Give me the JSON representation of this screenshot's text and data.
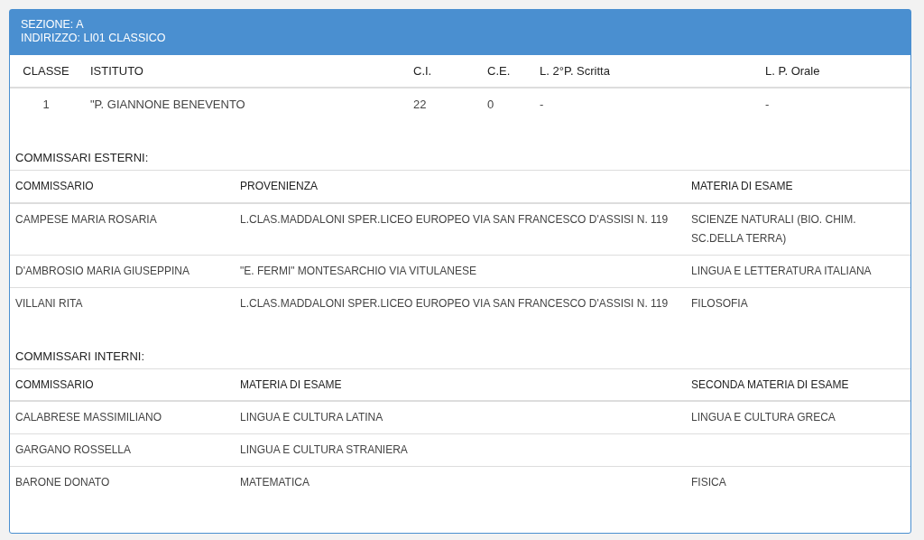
{
  "header": {
    "sezione": "SEZIONE: A",
    "indirizzo": "INDIRIZZO: LI01 CLASSICO"
  },
  "classi": {
    "columns": [
      "CLASSE",
      "ISTITUTO",
      "C.I.",
      "C.E.",
      "L. 2°P. Scritta",
      "L. P. Orale"
    ],
    "rows": [
      [
        "1",
        "\"P. GIANNONE BENEVENTO",
        "22",
        "0",
        "-",
        "-"
      ]
    ]
  },
  "sections": [
    {
      "title": "COMMISSARI ESTERNI:",
      "columns": [
        "COMMISSARIO",
        "PROVENIENZA",
        "MATERIA DI ESAME"
      ],
      "rows": [
        [
          "CAMPESE MARIA ROSARIA",
          "L.CLAS.MADDALONI SPER.LICEO EUROPEO VIA SAN FRANCESCO D'ASSISI N. 119",
          "SCIENZE NATURALI (BIO. CHIM. SC.DELLA TERRA)"
        ],
        [
          "D'AMBROSIO MARIA GIUSEPPINA",
          "\"E. FERMI\" MONTESARCHIO VIA VITULANESE",
          "LINGUA E LETTERATURA ITALIANA"
        ],
        [
          "VILLANI RITA",
          "L.CLAS.MADDALONI SPER.LICEO EUROPEO VIA SAN FRANCESCO D'ASSISI N. 119",
          "FILOSOFIA"
        ]
      ]
    },
    {
      "title": "COMMISSARI INTERNI:",
      "columns": [
        "COMMISSARIO",
        "MATERIA DI ESAME",
        "SECONDA MATERIA DI ESAME"
      ],
      "rows": [
        [
          "CALABRESE MASSIMILIANO",
          "LINGUA E CULTURA LATINA",
          "LINGUA E CULTURA GRECA"
        ],
        [
          "GARGANO ROSSELLA",
          "LINGUA E CULTURA STRANIERA"
        ],
        [
          "BARONE DONATO",
          "MATEMATICA",
          "FISICA"
        ]
      ]
    }
  ]
}
